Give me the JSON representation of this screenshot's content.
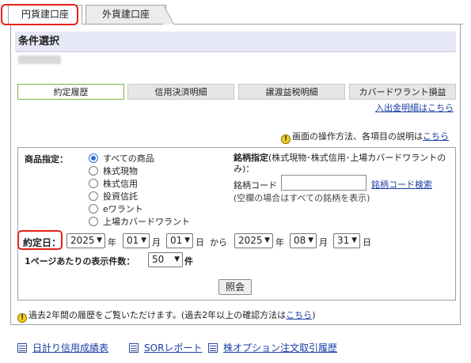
{
  "tabs": {
    "active": "円貨建口座",
    "inactive": "外貨建口座"
  },
  "header": {
    "title": "条件選択"
  },
  "menu": [
    {
      "label": "約定履歴"
    },
    {
      "label": "信用決済明細"
    },
    {
      "label": "譲渡益税明細"
    },
    {
      "label": "カバードワラント損益"
    }
  ],
  "links": {
    "deposit_withdrawal": "入出金明細はこちら",
    "help_prefix": "画面の操作方法、各項目の説明は",
    "help_link": "こちら"
  },
  "form": {
    "product_label": "商品指定：",
    "product_options": [
      "すべての商品",
      "株式現物",
      "株式信用",
      "投資信託",
      "eワラント",
      "上場カバードワラント"
    ],
    "stock_label_bold": "銘柄指定",
    "stock_label_note": "(株式現物･株式信用･上場カバードワラントのみ)：",
    "stock_code_label": "銘柄コード",
    "stock_code_value": "",
    "stock_search_link": "銘柄コード検索",
    "stock_hint": "(空欄の場合はすべての銘柄を表示)",
    "date_label": "約定日：",
    "from": {
      "year": "2025",
      "month": "01",
      "day": "01"
    },
    "to": {
      "year": "2025",
      "month": "08",
      "day": "31"
    },
    "unit_year": "年",
    "unit_month": "月",
    "unit_day": "日",
    "range_word": "から",
    "per_page_label": "1ページあたりの表示件数：",
    "per_page_value": "50",
    "per_page_unit": "件",
    "submit": "照会"
  },
  "notice": {
    "text": "過去2年間の履歴をご覧いただけます。(過去2年以上の確認方法は",
    "link": "こちら",
    "close": ")"
  },
  "bottom_links": [
    "日計り信用成績表",
    "SORレポート",
    "株オプション注文取引履歴"
  ]
}
